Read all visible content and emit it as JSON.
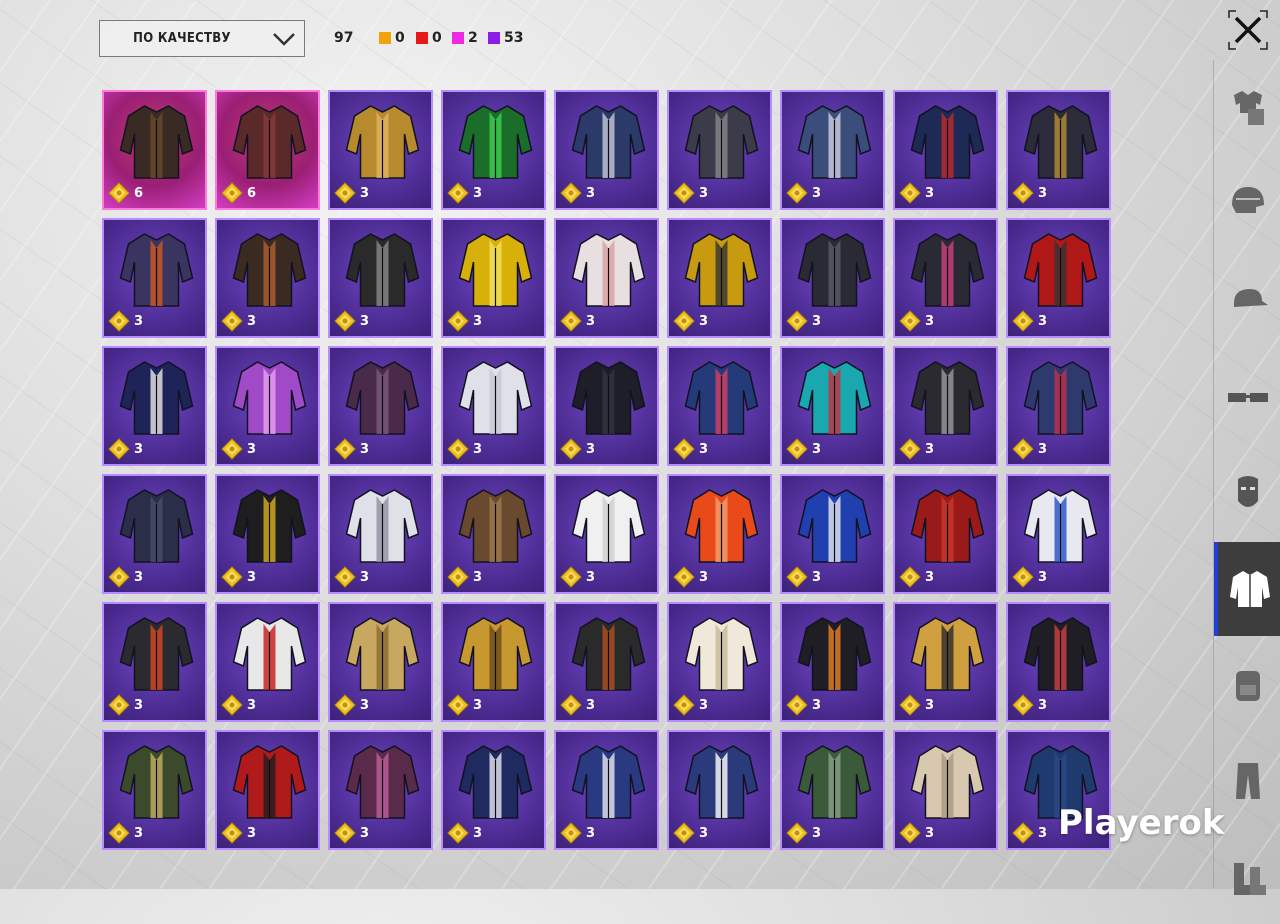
{
  "toolbar": {
    "sort_label": "ПО КАЧЕСТВУ",
    "total": "97",
    "stats": [
      {
        "color": "#f2a20c",
        "value": "0"
      },
      {
        "color": "#e81717",
        "value": "0"
      },
      {
        "color": "#ee2ae0",
        "value": "2"
      },
      {
        "color": "#8a1ce8",
        "value": "53"
      }
    ]
  },
  "grid": {
    "items": [
      {
        "value": "6",
        "rarity": "pink"
      },
      {
        "value": "6",
        "rarity": "pink"
      },
      {
        "value": "3",
        "rarity": "purple"
      },
      {
        "value": "3",
        "rarity": "purple"
      },
      {
        "value": "3",
        "rarity": "purple"
      },
      {
        "value": "3",
        "rarity": "purple"
      },
      {
        "value": "3",
        "rarity": "purple"
      },
      {
        "value": "3",
        "rarity": "purple"
      },
      {
        "value": "3",
        "rarity": "purple"
      },
      {
        "value": "3",
        "rarity": "purple"
      },
      {
        "value": "3",
        "rarity": "purple"
      },
      {
        "value": "3",
        "rarity": "purple"
      },
      {
        "value": "3",
        "rarity": "purple"
      },
      {
        "value": "3",
        "rarity": "purple"
      },
      {
        "value": "3",
        "rarity": "purple"
      },
      {
        "value": "3",
        "rarity": "purple"
      },
      {
        "value": "3",
        "rarity": "purple"
      },
      {
        "value": "3",
        "rarity": "purple"
      },
      {
        "value": "3",
        "rarity": "purple"
      },
      {
        "value": "3",
        "rarity": "purple"
      },
      {
        "value": "3",
        "rarity": "purple"
      },
      {
        "value": "3",
        "rarity": "purple"
      },
      {
        "value": "3",
        "rarity": "purple"
      },
      {
        "value": "3",
        "rarity": "purple"
      },
      {
        "value": "3",
        "rarity": "purple"
      },
      {
        "value": "3",
        "rarity": "purple"
      },
      {
        "value": "3",
        "rarity": "purple"
      },
      {
        "value": "3",
        "rarity": "purple"
      },
      {
        "value": "3",
        "rarity": "purple"
      },
      {
        "value": "3",
        "rarity": "purple"
      },
      {
        "value": "3",
        "rarity": "purple"
      },
      {
        "value": "3",
        "rarity": "purple"
      },
      {
        "value": "3",
        "rarity": "purple"
      },
      {
        "value": "3",
        "rarity": "purple"
      },
      {
        "value": "3",
        "rarity": "purple"
      },
      {
        "value": "3",
        "rarity": "purple"
      },
      {
        "value": "3",
        "rarity": "purple"
      },
      {
        "value": "3",
        "rarity": "purple"
      },
      {
        "value": "3",
        "rarity": "purple"
      },
      {
        "value": "3",
        "rarity": "purple"
      },
      {
        "value": "3",
        "rarity": "purple"
      },
      {
        "value": "3",
        "rarity": "purple"
      },
      {
        "value": "3",
        "rarity": "purple"
      },
      {
        "value": "3",
        "rarity": "purple"
      },
      {
        "value": "3",
        "rarity": "purple"
      },
      {
        "value": "3",
        "rarity": "purple"
      },
      {
        "value": "3",
        "rarity": "purple"
      },
      {
        "value": "3",
        "rarity": "purple"
      },
      {
        "value": "3",
        "rarity": "purple"
      },
      {
        "value": "3",
        "rarity": "purple"
      },
      {
        "value": "3",
        "rarity": "purple"
      },
      {
        "value": "3",
        "rarity": "purple"
      },
      {
        "value": "3",
        "rarity": "purple"
      },
      {
        "value": "3",
        "rarity": "purple"
      }
    ],
    "coin_icon": "coin-diamond-icon",
    "item_icon": "jacket-icon"
  },
  "sidebar": {
    "categories": [
      {
        "icon": "outfit-icon",
        "active": false
      },
      {
        "icon": "helmet-icon",
        "active": false
      },
      {
        "icon": "cap-icon",
        "active": false
      },
      {
        "icon": "glasses-icon",
        "active": false
      },
      {
        "icon": "mask-icon",
        "active": false
      },
      {
        "icon": "jacket-icon",
        "active": true
      },
      {
        "icon": "backpack-icon",
        "active": false
      },
      {
        "icon": "pants-icon",
        "active": false
      },
      {
        "icon": "shoes-icon",
        "active": false
      }
    ],
    "active_color": "#1e3fd8"
  },
  "close_icon": "close-icon",
  "watermark": "Playerok"
}
